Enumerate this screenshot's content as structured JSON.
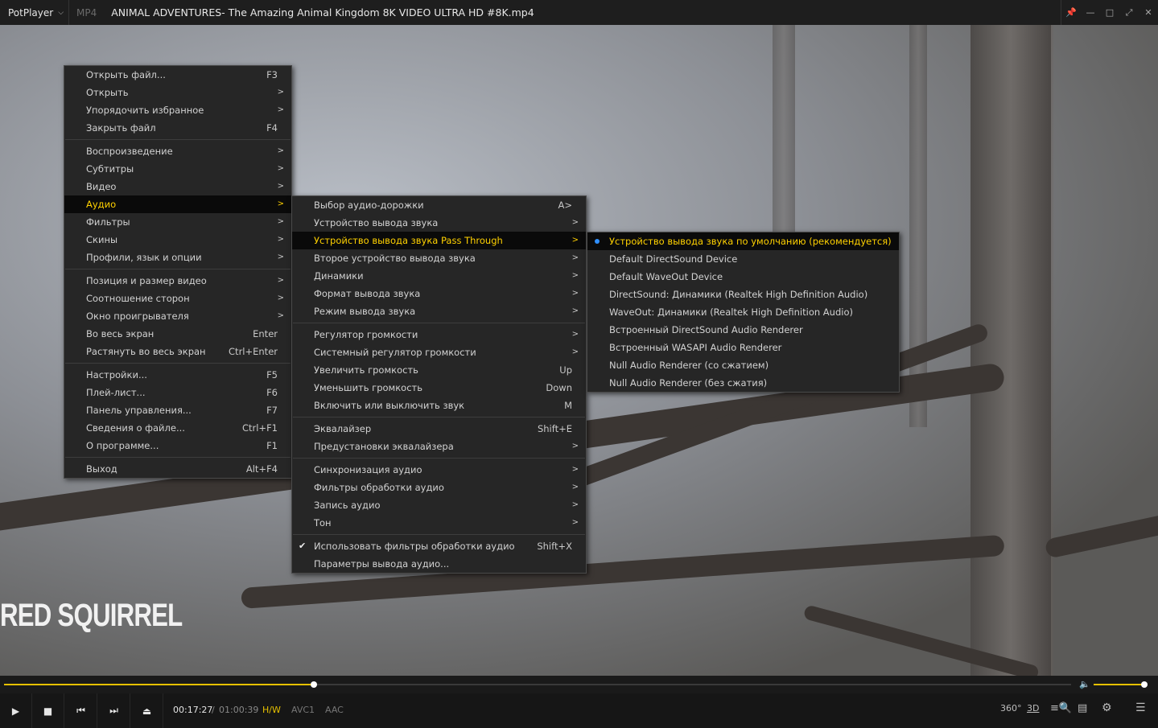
{
  "titlebar": {
    "app_name": "PotPlayer",
    "format": "MP4",
    "filename": "ANIMAL ADVENTURES- The Amazing Animal Kingdom 8K VIDEO ULTRA HD #8K.mp4",
    "icons": [
      "pin-icon",
      "minimize-icon",
      "maximize-icon",
      "fullscreen-icon",
      "close-icon"
    ]
  },
  "video": {
    "overlay_text": "RED SQUIRREL"
  },
  "main_menu": {
    "groups": [
      [
        {
          "label": "Открыть файл...",
          "shortcut": "F3"
        },
        {
          "label": "Открыть",
          "arrow": ">"
        },
        {
          "label": "Упорядочить избранное",
          "arrow": ">"
        },
        {
          "label": "Закрыть файл",
          "shortcut": "F4"
        }
      ],
      [
        {
          "label": "Воспроизведение",
          "arrow": ">"
        },
        {
          "label": "Субтитры",
          "arrow": ">"
        },
        {
          "label": "Видео",
          "arrow": ">"
        },
        {
          "label": "Аудио",
          "arrow": ">",
          "highlighted": true
        },
        {
          "label": "Фильтры",
          "arrow": ">"
        },
        {
          "label": "Скины",
          "arrow": ">"
        },
        {
          "label": "Профили, язык и опции",
          "arrow": ">"
        }
      ],
      [
        {
          "label": "Позиция и размер видео",
          "arrow": ">"
        },
        {
          "label": "Соотношение сторон",
          "arrow": ">"
        },
        {
          "label": "Окно проигрывателя",
          "arrow": ">"
        },
        {
          "label": "Во весь экран",
          "shortcut": "Enter"
        },
        {
          "label": "Растянуть во весь экран",
          "shortcut": "Ctrl+Enter"
        }
      ],
      [
        {
          "label": "Настройки...",
          "shortcut": "F5"
        },
        {
          "label": "Плей-лист...",
          "shortcut": "F6"
        },
        {
          "label": "Панель управления...",
          "shortcut": "F7"
        },
        {
          "label": "Сведения о файле...",
          "shortcut": "Ctrl+F1"
        },
        {
          "label": "О программе...",
          "shortcut": "F1"
        }
      ],
      [
        {
          "label": "Выход",
          "shortcut": "Alt+F4"
        }
      ]
    ]
  },
  "audio_menu": {
    "groups": [
      [
        {
          "label": "Выбор аудио-дорожки",
          "shortcut": "A>"
        },
        {
          "label": "Устройство вывода звука",
          "arrow": ">"
        },
        {
          "label": "Устройство вывода звука Pass Through",
          "arrow": ">",
          "highlighted": true
        },
        {
          "label": "Второе устройство вывода звука",
          "arrow": ">"
        },
        {
          "label": "Динамики",
          "arrow": ">"
        },
        {
          "label": "Формат вывода звука",
          "arrow": ">"
        },
        {
          "label": "Режим вывода звука",
          "arrow": ">"
        }
      ],
      [
        {
          "label": "Регулятор громкости",
          "arrow": ">"
        },
        {
          "label": "Системный регулятор громкости",
          "arrow": ">"
        },
        {
          "label": "Увеличить громкость",
          "shortcut": "Up"
        },
        {
          "label": "Уменьшить громкость",
          "shortcut": "Down"
        },
        {
          "label": "Включить или выключить звук",
          "shortcut": "M"
        }
      ],
      [
        {
          "label": "Эквалайзер",
          "shortcut": "Shift+E"
        },
        {
          "label": "Предустановки эквалайзера",
          "arrow": ">"
        }
      ],
      [
        {
          "label": "Синхронизация аудио",
          "arrow": ">"
        },
        {
          "label": "Фильтры обработки аудио",
          "arrow": ">"
        },
        {
          "label": "Запись аудио",
          "arrow": ">"
        },
        {
          "label": "Тон",
          "arrow": ">"
        }
      ],
      [
        {
          "label": "Использовать фильтры обработки аудио",
          "shortcut": "Shift+X",
          "checked": true
        },
        {
          "label": "Параметры вывода аудио..."
        }
      ]
    ]
  },
  "device_menu": {
    "items": [
      {
        "label": "Устройство вывода звука по умолчанию (рекомендуется)",
        "highlighted": true,
        "selected": true
      },
      {
        "label": "Default DirectSound Device"
      },
      {
        "label": "Default WaveOut Device"
      },
      {
        "label": "DirectSound: Динамики (Realtek High Definition Audio)"
      },
      {
        "label": "WaveOut: Динамики (Realtek High Definition Audio)"
      },
      {
        "label": "Встроенный DirectSound Audio Renderer"
      },
      {
        "label": "Встроенный WASAPI Audio Renderer"
      },
      {
        "label": "Null Audio Renderer (со сжатием)"
      },
      {
        "label": "Null Audio Renderer (без сжатия)"
      }
    ]
  },
  "playback": {
    "current_time": "00:17:27",
    "separator": "/",
    "total_time": "01:00:39",
    "progress_fraction": 0.29,
    "volume_fraction": 0.98,
    "hw_tag": "H/W",
    "video_codec": "AVC1",
    "audio_codec": "AAC",
    "right_icons": {
      "vr": "360°",
      "three_d": "3D"
    }
  },
  "colors": {
    "accent": "#e6c000",
    "highlight_text": "#ffd100",
    "selected_dot": "#2f8fff"
  }
}
